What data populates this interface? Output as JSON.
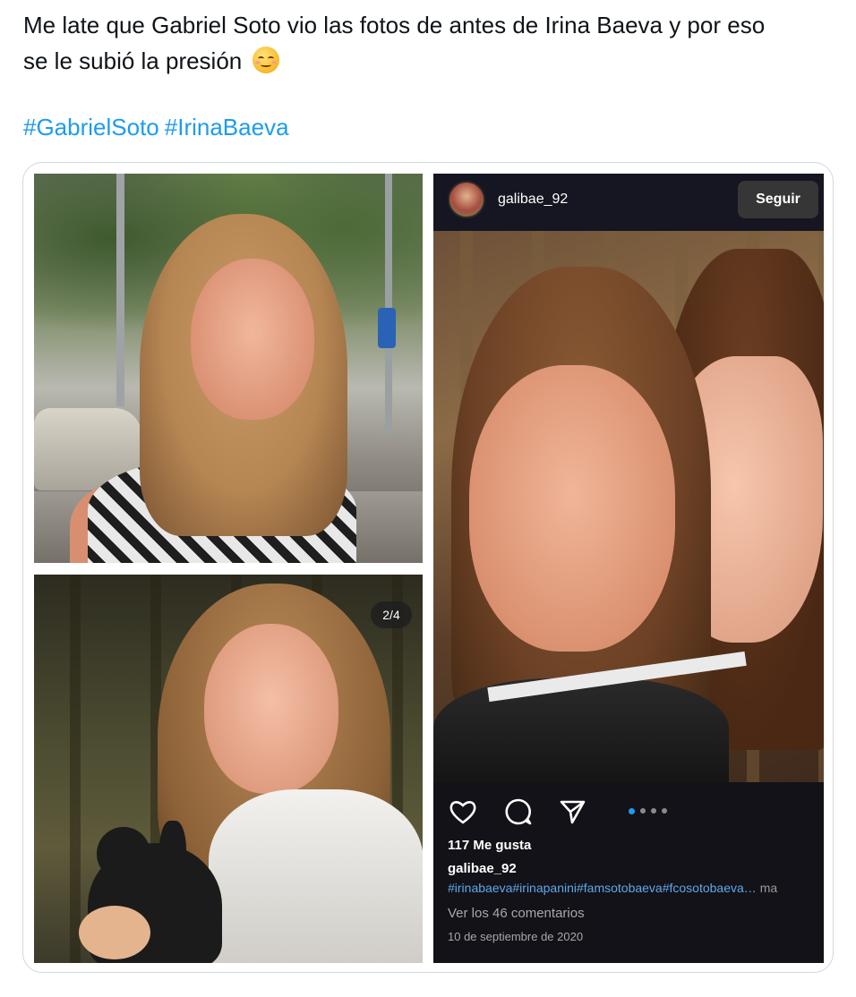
{
  "tweet": {
    "text_line1": "Me late que Gabriel Soto vio las fotos de antes de Irina Baeva y por eso",
    "text_line2": "se le subió la presión",
    "emoji_name": "relieved-face-emoji",
    "hashtags": [
      "#GabrielSoto",
      "#IrinaBaeva"
    ],
    "link_color": "#1d9bf0"
  },
  "media": {
    "counter_badge": "2/4",
    "instagram": {
      "username": "galibae_92",
      "follow_label": "Seguir",
      "icons": [
        "heart-icon",
        "comment-icon",
        "share-icon"
      ],
      "carousel_dots": 4,
      "carousel_active": 1,
      "likes": "117 Me gusta",
      "caption_user": "galibae_92",
      "caption_tags": "#irinabaeva#irinapanini#famsotobaeva#fcosotobaeva…",
      "caption_more": "ma",
      "comments_link": "Ver los 46 comentarios",
      "date": "10 de septiembre de 2020"
    }
  }
}
